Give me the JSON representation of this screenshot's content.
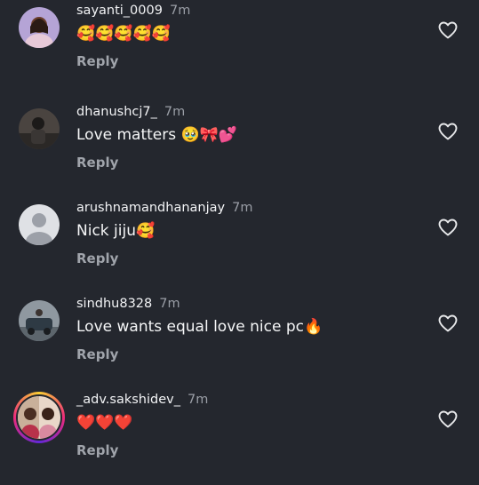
{
  "comments": [
    {
      "username": "sayanti_0009",
      "time": "7m",
      "text": "🥰🥰🥰🥰🥰",
      "reply": "Reply",
      "avatar": "photo-avatar",
      "like_icon": "heart-outline-icon"
    },
    {
      "username": "dhanushcj7_",
      "time": "7m",
      "text": "Love matters 🥹🎀💕",
      "reply": "Reply",
      "avatar": "photo-avatar",
      "like_icon": "heart-outline-icon"
    },
    {
      "username": "arushnamandhananjay",
      "time": "7m",
      "text": "Nick jiju🥰",
      "reply": "Reply",
      "avatar": "default-user-avatar",
      "like_icon": "heart-outline-icon"
    },
    {
      "username": "sindhu8328",
      "time": "7m",
      "text": "Love wants equal love nice pc🔥",
      "reply": "Reply",
      "avatar": "photo-avatar",
      "like_icon": "heart-outline-icon"
    },
    {
      "username": "_adv.sakshidev_",
      "time": "7m",
      "text": "❤️❤️❤️",
      "reply": "Reply",
      "avatar": "story-ring-avatar",
      "like_icon": "heart-outline-icon"
    }
  ],
  "colors": {
    "background": "#24272e",
    "muted": "#9a9ea6",
    "text": "#f2f3f5"
  }
}
